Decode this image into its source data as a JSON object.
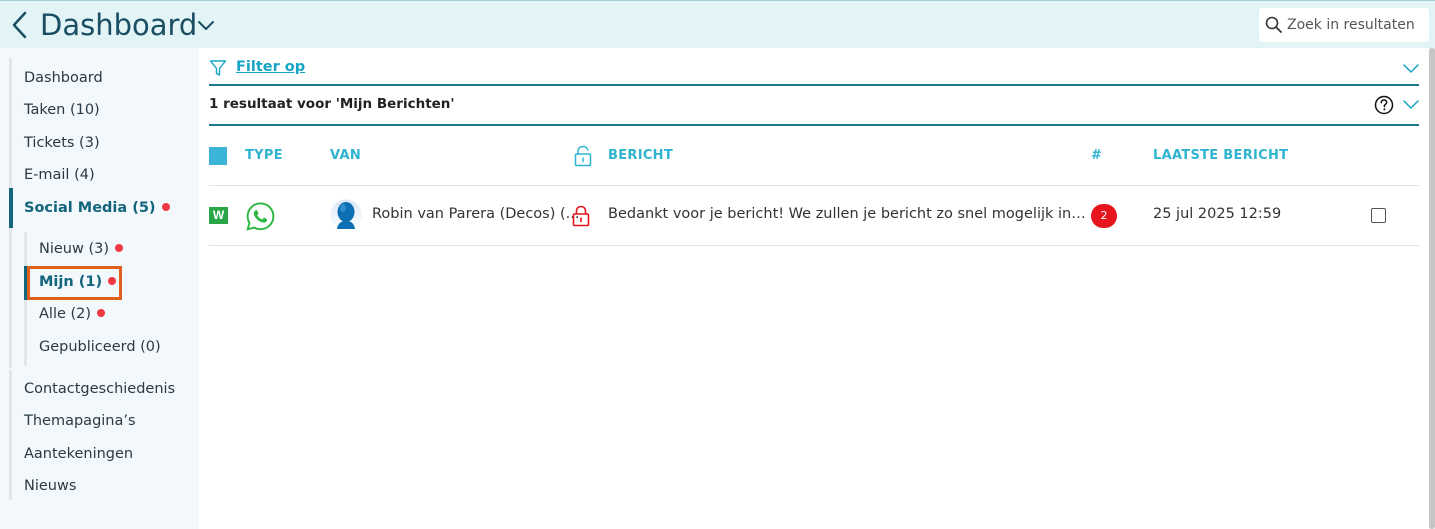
{
  "header": {
    "title": "Dashboard",
    "search_placeholder": "Zoek in resultaten"
  },
  "sidebar": {
    "items": [
      {
        "label": "Dashboard"
      },
      {
        "label": "Taken (10)"
      },
      {
        "label": "Tickets (3)"
      },
      {
        "label": "E-mail (4)"
      },
      {
        "label": "Social Media (5)",
        "active": true,
        "dot": true
      }
    ],
    "sub_items": [
      {
        "label": "Nieuw (3)",
        "dot": true
      },
      {
        "label": "Mijn (1)",
        "dot": true,
        "active": true
      },
      {
        "label": "Alle (2)",
        "dot": true
      },
      {
        "label": "Gepubliceerd (0)"
      }
    ],
    "more_items": [
      {
        "label": "Contactgeschiedenis"
      },
      {
        "label": "Themapagina’s"
      },
      {
        "label": "Aantekeningen"
      },
      {
        "label": "Nieuws"
      }
    ]
  },
  "filter": {
    "label": "Filter op"
  },
  "results": {
    "summary": "1 resultaat voor 'Mijn Berichten'"
  },
  "table": {
    "columns": {
      "type": "TYPE",
      "from": "VAN",
      "message": "BERICHT",
      "count": "#",
      "last": "LAATSTE BERICHT"
    },
    "rows": [
      {
        "badge": "W",
        "channel_icon": "whatsapp-icon",
        "from": "Robin van Parera (Decos) (...",
        "message": "Bedankt voor je bericht! We zullen je bericht zo snel mogelijk in be...",
        "count": "2",
        "last": "25 jul 2025 12:59"
      }
    ]
  },
  "colors": {
    "accent": "#13657c",
    "link": "#17a5c6",
    "notification": "#ee3a44",
    "header_bg": "#e3f4f6",
    "highlight": "#e05f1e"
  }
}
